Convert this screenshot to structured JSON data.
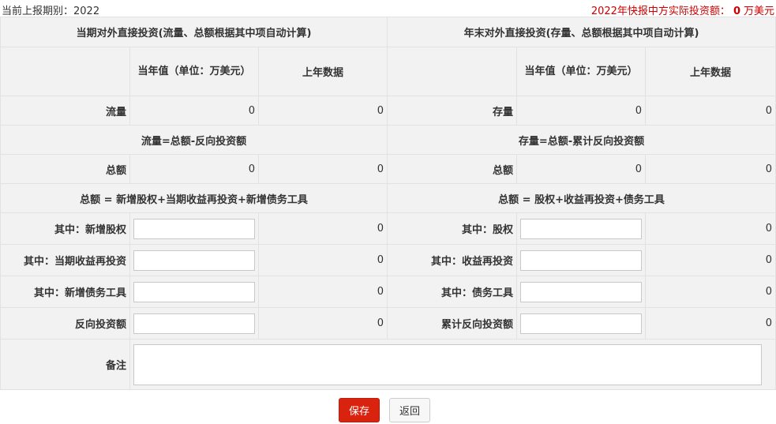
{
  "header": {
    "period_label": "当前上报期别：2022",
    "actual_prefix": "2022年快报中方实际投资额：",
    "actual_value": "0",
    "actual_unit": "万美元"
  },
  "table": {
    "flow_title": "当期对外直接投资(流量、总额根据其中项自动计算)",
    "stock_title": "年末对外直接投资(存量、总额根据其中项自动计算)",
    "col_current": "当年值（单位：万美元）",
    "col_previous": "上年数据",
    "flow_label": "流量",
    "flow_current": "0",
    "flow_previous": "0",
    "stock_label": "存量",
    "stock_current": "0",
    "stock_previous": "0",
    "flow_formula": "流量=总额-反向投资额",
    "stock_formula": "存量=总额-累计反向投资额",
    "total_label": "总额",
    "flow_total_current": "0",
    "flow_total_previous": "0",
    "stock_total_current": "0",
    "stock_total_previous": "0",
    "flow_total_formula": "总额 = 新增股权+当期收益再投资+新增债务工具",
    "stock_total_formula": "总额 = 股权+收益再投资+债务工具",
    "rows": [
      {
        "flow_label": "其中：新增股权",
        "flow_value": "",
        "flow_prev": "0",
        "stock_label": "其中：股权",
        "stock_value": "",
        "stock_prev": "0"
      },
      {
        "flow_label": "其中：当期收益再投资",
        "flow_value": "",
        "flow_prev": "0",
        "stock_label": "其中：收益再投资",
        "stock_value": "",
        "stock_prev": "0"
      },
      {
        "flow_label": "其中：新增债务工具",
        "flow_value": "",
        "flow_prev": "0",
        "stock_label": "其中：债务工具",
        "stock_value": "",
        "stock_prev": "0"
      },
      {
        "flow_label": "反向投资额",
        "flow_value": "",
        "flow_prev": "0",
        "stock_label": "累计反向投资额",
        "stock_value": "",
        "stock_prev": "0"
      }
    ],
    "remark_label": "备注",
    "remark_value": ""
  },
  "buttons": {
    "save": "保存",
    "back": "返回"
  },
  "colors": {
    "accent_red": "#d9230f",
    "alert_red": "#dd0000",
    "cell_bg": "#f2f2f2"
  }
}
